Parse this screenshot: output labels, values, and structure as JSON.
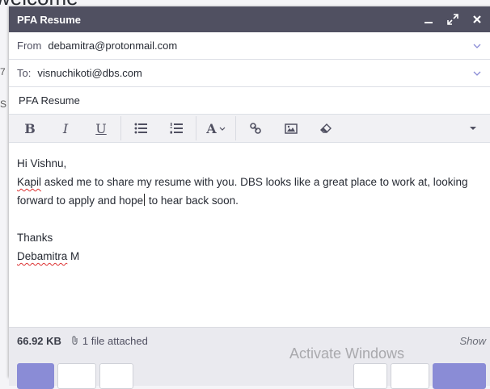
{
  "background": {
    "heading": "welcome",
    "fragment_1": "7",
    "fragment_2": "S"
  },
  "composer": {
    "title": "PFA Resume",
    "controls": {
      "minimize_icon": "minimize-icon",
      "expand_icon": "expand-icon",
      "close_icon": "close-icon"
    },
    "from": {
      "label": "From",
      "value": "debamitra@protonmail.com"
    },
    "to": {
      "label": "To:",
      "value": "visnuchikoti@dbs.com"
    },
    "subject": "PFA Resume",
    "toolbar": {
      "bold": "B",
      "italic": "I",
      "underline": "U",
      "font": "A",
      "icons": [
        "bullet-list-icon",
        "numbered-list-icon",
        "link-icon",
        "image-icon",
        "eraser-icon",
        "more-icon"
      ]
    },
    "body": {
      "greeting": "Hi Vishnu,",
      "line1_word": "Kapil",
      "line1_rest": " asked me to share my resume with you. DBS looks like a great place to work at, looking",
      "line2_before": "forward to apply and hope",
      "line2_after": " to hear back soon.",
      "closing": "Thanks",
      "signature_first": "Debamitra",
      "signature_rest": " M"
    },
    "footer": {
      "size": "66.92 KB",
      "attached": "1 file attached",
      "show": "Show"
    }
  },
  "watermark": "Activate Windows",
  "colors": {
    "titlebar": "#505061",
    "toolbar": "#f1f1f4",
    "footer": "#eaeaef",
    "primary_button": "#8a8cd6"
  }
}
